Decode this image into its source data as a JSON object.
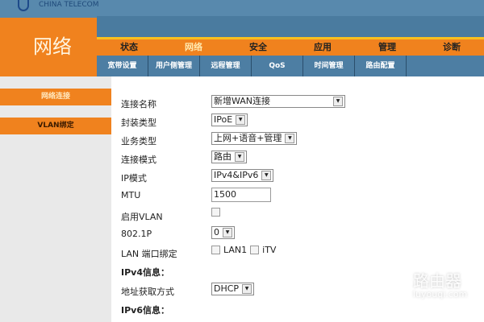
{
  "brand": {
    "logo_text": "CHINA TELECOM"
  },
  "section_title": "网络",
  "main_menu": [
    "状态",
    "网络",
    "安全",
    "应用",
    "管理",
    "诊断"
  ],
  "sub_menu": [
    "宽带设置",
    "用户侧管理",
    "远程管理",
    "QoS",
    "时间管理",
    "路由配置"
  ],
  "sidebar": [
    "网络连接",
    "VLAN绑定"
  ],
  "form": {
    "conn_name": {
      "label": "连接名称",
      "value": "新增WAN连接"
    },
    "encap": {
      "label": "封装类型",
      "value": "IPoE"
    },
    "service": {
      "label": "业务类型",
      "value": "上网+语音+管理"
    },
    "mode": {
      "label": "连接模式",
      "value": "路由"
    },
    "ipmode": {
      "label": "IP模式",
      "value": "IPv4&IPv6"
    },
    "mtu": {
      "label": "MTU",
      "value": "1500"
    },
    "vlan": {
      "label": "启用VLAN"
    },
    "dot1p": {
      "label": "802.1P",
      "value": "0"
    },
    "lanbind": {
      "label": "LAN 端口绑定",
      "opt1": "LAN1",
      "opt2": "iTV"
    },
    "ipv4_header": "IPv4信息：",
    "addr": {
      "label": "地址获取方式",
      "value": "DHCP"
    },
    "ipv6_header": "IPv6信息："
  },
  "watermark": {
    "name": "路由器",
    "url": "luyouqi.com"
  }
}
